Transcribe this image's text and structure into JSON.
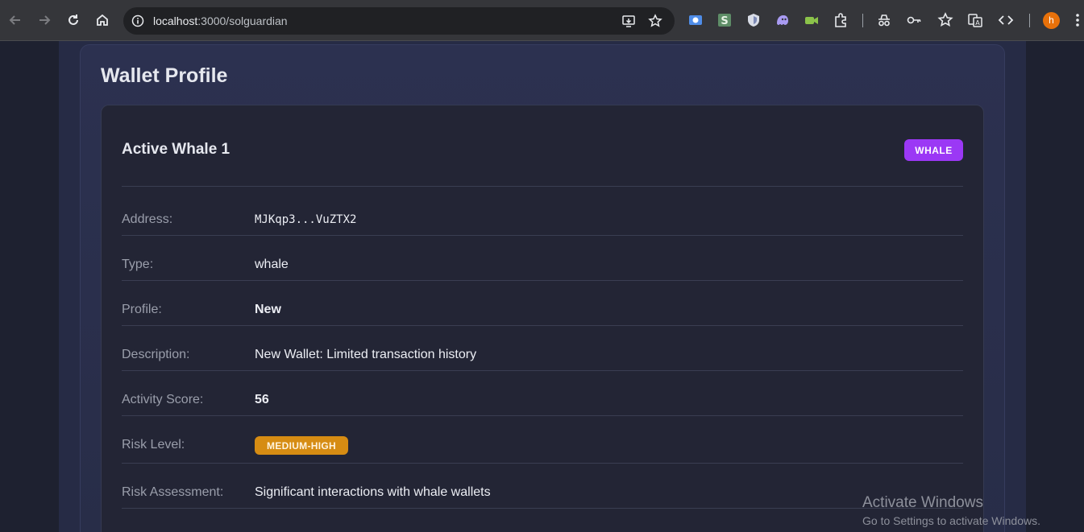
{
  "browser": {
    "url_host": "localhost",
    "url_path": ":3000/solguardian",
    "avatar_letter": "h"
  },
  "profile": {
    "section_title": "Wallet Profile",
    "wallet_name": "Active Whale 1",
    "badge": "WHALE",
    "rows": [
      {
        "label": "Address:",
        "value": "MJKqp3...VuZTX2"
      },
      {
        "label": "Type:",
        "value": "whale"
      },
      {
        "label": "Profile:",
        "value": "New"
      },
      {
        "label": "Description:",
        "value": "New Wallet: Limited transaction history"
      },
      {
        "label": "Activity Score:",
        "value": "56"
      },
      {
        "label": "Risk Level:",
        "value": "MEDIUM-HIGH"
      },
      {
        "label": "Risk Assessment:",
        "value": "Significant interactions with whale wallets"
      }
    ]
  },
  "colors": {
    "whale_badge": "#9b38f5",
    "risk_badge": "#d68c13",
    "page_bg": "#1e2130"
  },
  "watermark": {
    "title": "Activate Windows",
    "subtitle": "Go to Settings to activate Windows."
  }
}
